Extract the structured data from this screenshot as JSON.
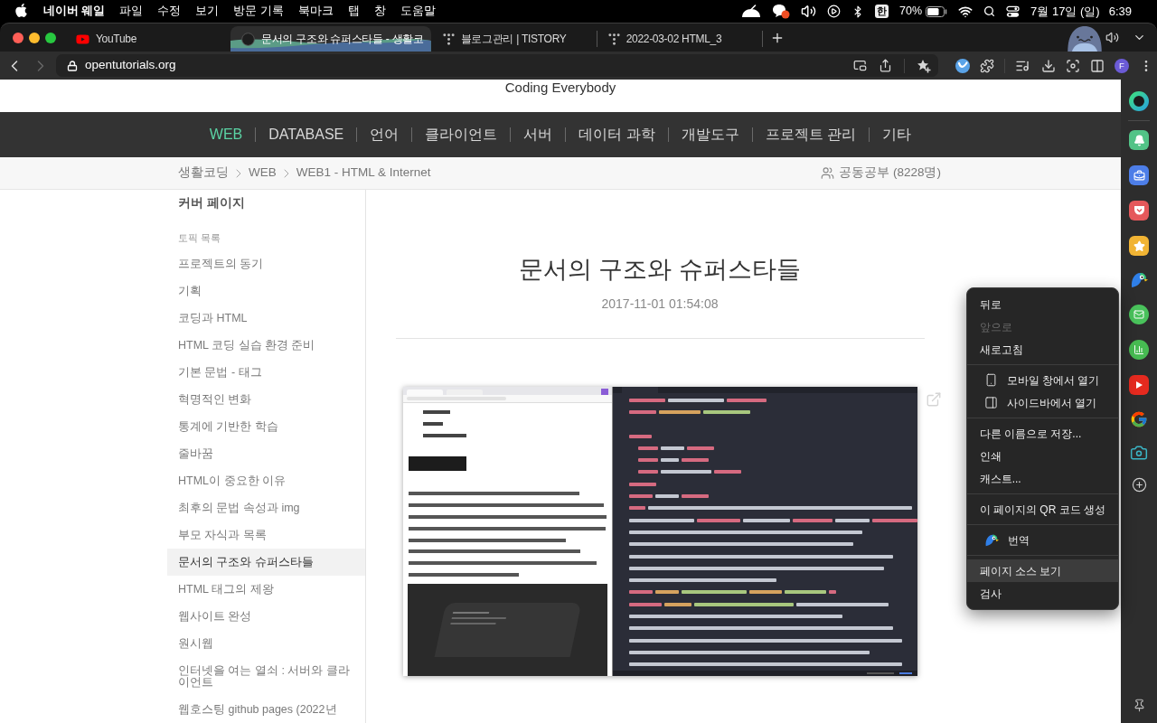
{
  "menu_bar": {
    "app": "네이버 웨일",
    "menus": [
      "파일",
      "수정",
      "보기",
      "방문 기록",
      "북마크",
      "탭",
      "창",
      "도움말"
    ],
    "input_source": "한",
    "battery": "70%",
    "date": "7월 17일 (일)",
    "time": "6:39"
  },
  "tabs": [
    {
      "title": "YouTube",
      "selected": false
    },
    {
      "title": "문서의 구조와 슈퍼스타들 - 생활코",
      "selected": true
    },
    {
      "title": "블로그관리 | TISTORY",
      "selected": false
    },
    {
      "title": "2022-03-02 HTML_3",
      "selected": false
    }
  ],
  "toolbar": {
    "url": "opentutorials.org",
    "profile_initial": "F"
  },
  "site": {
    "tagline": "Coding Everybody",
    "nav": [
      {
        "label": "WEB",
        "selected": true
      },
      {
        "label": "DATABASE",
        "selected": false
      },
      {
        "label": "언어",
        "selected": false
      },
      {
        "label": "클라이언트",
        "selected": false
      },
      {
        "label": "서버",
        "selected": false
      },
      {
        "label": "데이터 과학",
        "selected": false
      },
      {
        "label": "개발도구",
        "selected": false
      },
      {
        "label": "프로젝트 관리",
        "selected": false
      },
      {
        "label": "기타",
        "selected": false
      }
    ],
    "breadcrumb": [
      "생활코딩",
      "WEB",
      "WEB1 - HTML & Internet"
    ],
    "study_group": "공동공부 (8228명)"
  },
  "sidebar": {
    "cover": "커버 페이지",
    "section_title": "토픽 목록",
    "topics": [
      {
        "label": "프로젝트의 동기",
        "selected": false
      },
      {
        "label": "기획",
        "selected": false
      },
      {
        "label": "코딩과 HTML",
        "selected": false
      },
      {
        "label": "HTML 코딩 실습 환경 준비",
        "selected": false
      },
      {
        "label": "기본 문법 - 태그",
        "selected": false
      },
      {
        "label": "혁명적인 변화",
        "selected": false
      },
      {
        "label": "통계에 기반한 학습",
        "selected": false
      },
      {
        "label": "줄바꿈",
        "selected": false
      },
      {
        "label": "HTML이 중요한 이유",
        "selected": false
      },
      {
        "label": "최후의 문법 속성과 img",
        "selected": false
      },
      {
        "label": "부모 자식과 목록",
        "selected": false
      },
      {
        "label": "문서의 구조와 슈퍼스타들",
        "selected": true
      },
      {
        "label": "HTML 태그의 제왕",
        "selected": false
      },
      {
        "label": "웹사이트 완성",
        "selected": false
      },
      {
        "label": "원시웹",
        "selected": false
      },
      {
        "label": "인터넷을 여는 열쇠 : 서버와 클라이언트",
        "selected": false
      },
      {
        "label": "웹호스팅 github pages (2022년",
        "selected": false
      }
    ]
  },
  "article": {
    "title": "문서의 구조와 슈퍼스타들",
    "date": "2017-11-01 01:54:08"
  },
  "context_menu": {
    "groups": [
      [
        {
          "label": "뒤로",
          "kind": "plain",
          "disabled": false,
          "selected": false
        },
        {
          "label": "앞으로",
          "kind": "plain",
          "disabled": true,
          "selected": false
        },
        {
          "label": "새로고침",
          "kind": "plain",
          "disabled": false,
          "selected": false
        }
      ],
      [
        {
          "label": "모바일 창에서 열기",
          "kind": "icon",
          "disabled": false,
          "selected": false
        },
        {
          "label": "사이드바에서 열기",
          "kind": "icon",
          "disabled": false,
          "selected": false
        }
      ],
      [
        {
          "label": "다른 이름으로 저장...",
          "kind": "plain",
          "disabled": false,
          "selected": false
        },
        {
          "label": "인쇄",
          "kind": "plain",
          "disabled": false,
          "selected": false
        },
        {
          "label": "캐스트...",
          "kind": "plain",
          "disabled": false,
          "selected": false
        }
      ],
      [
        {
          "label": "이 페이지의 QR 코드 생성",
          "kind": "plain",
          "disabled": false,
          "selected": false
        }
      ],
      [
        {
          "label": "번역",
          "kind": "icon",
          "disabled": false,
          "selected": false
        }
      ],
      [
        {
          "label": "페이지 소스 보기",
          "kind": "plain",
          "disabled": false,
          "selected": true
        },
        {
          "label": "검사",
          "kind": "plain",
          "disabled": false,
          "selected": false
        }
      ]
    ]
  }
}
